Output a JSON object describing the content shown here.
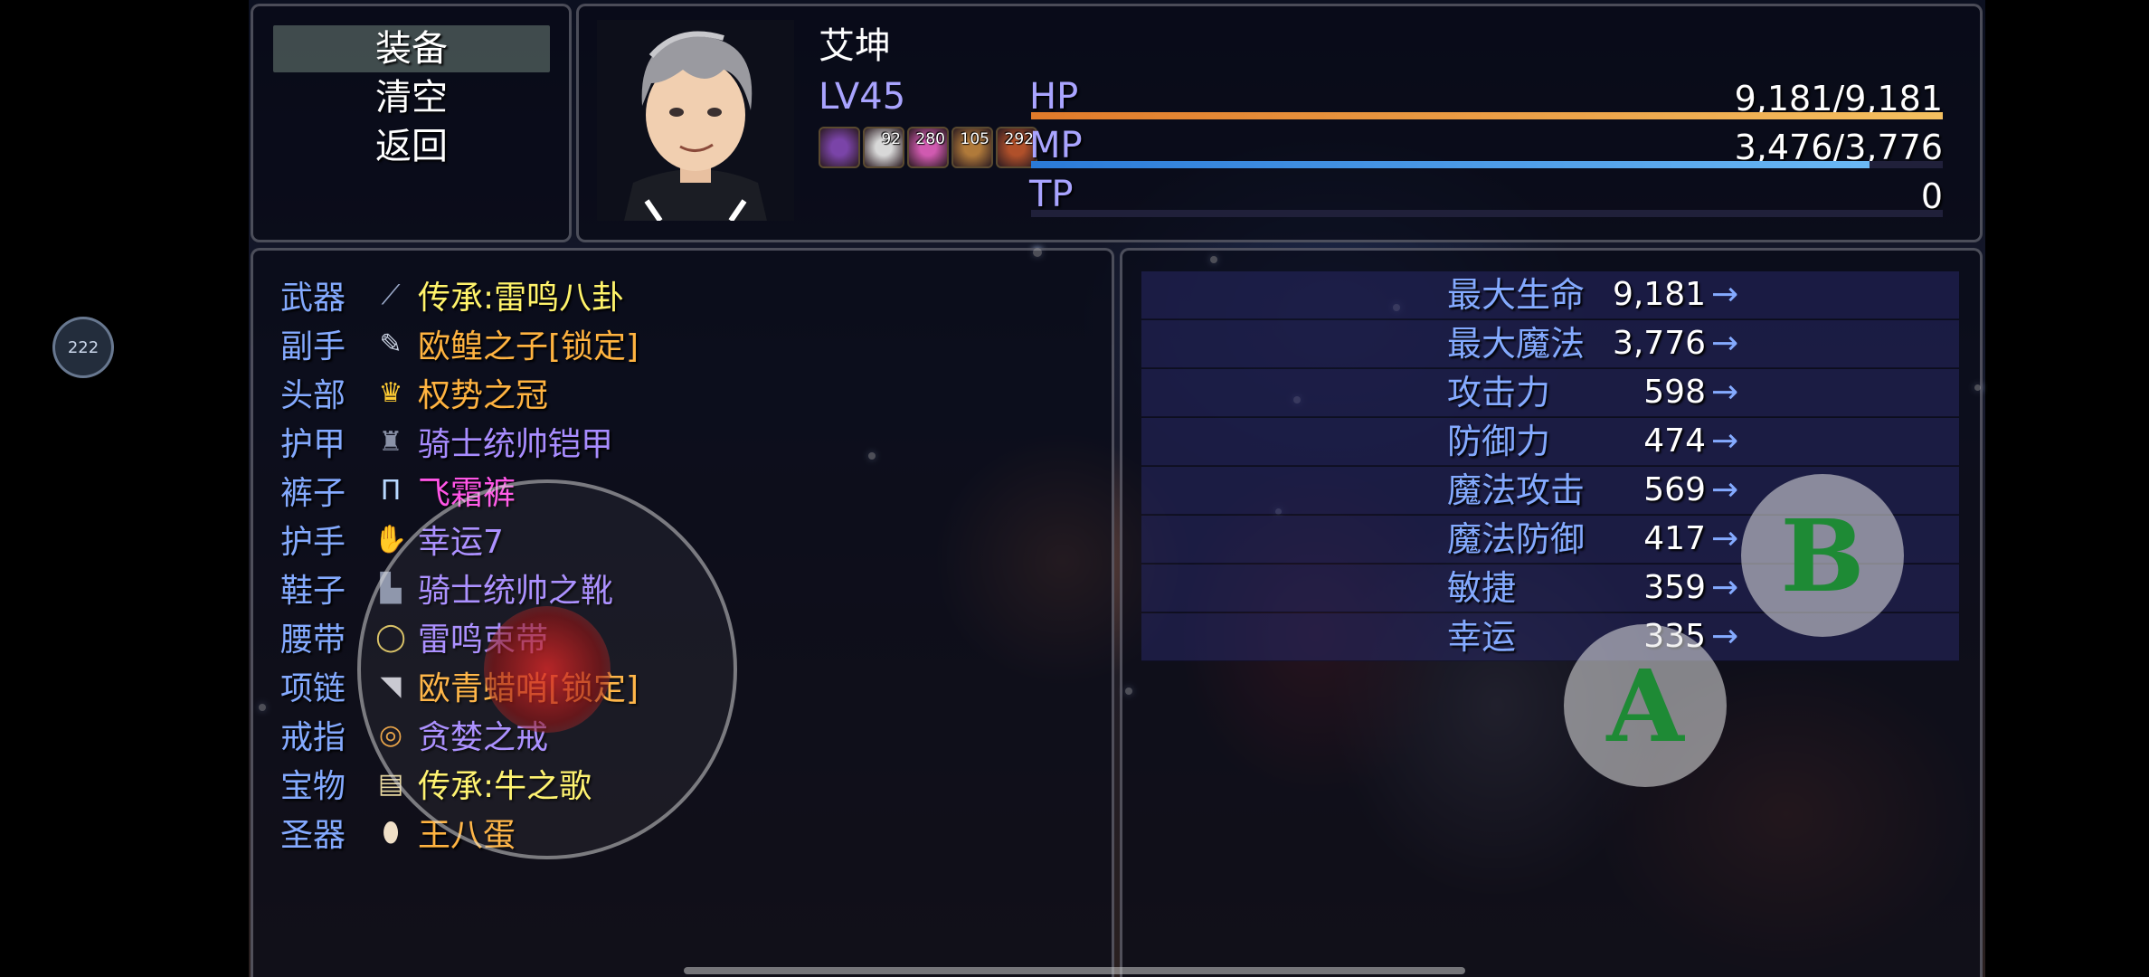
{
  "command_menu": {
    "items": [
      "装备",
      "清空",
      "返回"
    ],
    "selected_index": 0
  },
  "actor": {
    "name": "艾坤",
    "level": "LV45",
    "states": [
      {
        "icon": "demon-mouth-icon",
        "turns": "",
        "color": "#7a44a8"
      },
      {
        "icon": "skull-icon",
        "turns": "92",
        "color": "#d8d8d8"
      },
      {
        "icon": "pink-spiral-icon",
        "turns": "280",
        "color": "#d05ab0"
      },
      {
        "icon": "shield-buff-icon",
        "turns": "105",
        "color": "#b07a3a"
      },
      {
        "icon": "crossed-swords-icon",
        "turns": "292",
        "color": "#b0502a"
      }
    ],
    "hp": {
      "label": "HP",
      "value": "9,181/9,181",
      "fraction": 1.0,
      "color_start": "#e07a2a",
      "color_end": "#f4c060"
    },
    "mp": {
      "label": "MP",
      "value": "3,476/3,776",
      "fraction": 0.92,
      "color_start": "#2a7ad8",
      "color_end": "#6ab8f4"
    },
    "tp": {
      "label": "TP",
      "value": "0",
      "fraction": 0.0,
      "color_start": "#2ab05a",
      "color_end": "#7ae07a"
    }
  },
  "equip_slots": [
    {
      "slot": "武器",
      "icon": "spear-icon",
      "item": "传承:雷鸣八卦",
      "color": "#fff36a"
    },
    {
      "slot": "副手",
      "icon": "blade-icon",
      "item": "欧鳇之子[锁定]",
      "color": "#ffb340"
    },
    {
      "slot": "头部",
      "icon": "crown-icon",
      "item": "权势之冠",
      "color": "#ffb340"
    },
    {
      "slot": "护甲",
      "icon": "armor-icon",
      "item": "骑士统帅铠甲",
      "color": "#a88cff"
    },
    {
      "slot": "裤子",
      "icon": "pants-icon",
      "item": "飞霜裤",
      "color": "#ff55e6"
    },
    {
      "slot": "护手",
      "icon": "gauntlet-icon",
      "item": "幸运7",
      "color": "#a88cff"
    },
    {
      "slot": "鞋子",
      "icon": "boots-icon",
      "item": "骑士统帅之靴",
      "color": "#a88cff"
    },
    {
      "slot": "腰带",
      "icon": "belt-icon",
      "item": "雷鸣束带",
      "color": "#a88cff"
    },
    {
      "slot": "项链",
      "icon": "whistle-icon",
      "item": "欧青蜡哨[锁定]",
      "color": "#ffb340"
    },
    {
      "slot": "戒指",
      "icon": "ring-icon",
      "item": "贪婪之戒",
      "color": "#a88cff"
    },
    {
      "slot": "宝物",
      "icon": "scroll-icon",
      "item": "传承:牛之歌",
      "color": "#fff36a"
    },
    {
      "slot": "圣器",
      "icon": "egg-icon",
      "item": "王八蛋",
      "color": "#ffb340"
    }
  ],
  "params": [
    {
      "name": "最大生命",
      "value": "9,181"
    },
    {
      "name": "最大魔法",
      "value": "3,776"
    },
    {
      "name": "攻击力",
      "value": "598"
    },
    {
      "name": "防御力",
      "value": "474"
    },
    {
      "name": "魔法攻击",
      "value": "569"
    },
    {
      "name": "魔法防御",
      "value": "417"
    },
    {
      "name": "敏捷",
      "value": "359"
    },
    {
      "name": "幸运",
      "value": "335"
    }
  ],
  "param_arrow": "→",
  "controls": {
    "button_a": "A",
    "button_b": "B",
    "fps_badge": "222"
  }
}
